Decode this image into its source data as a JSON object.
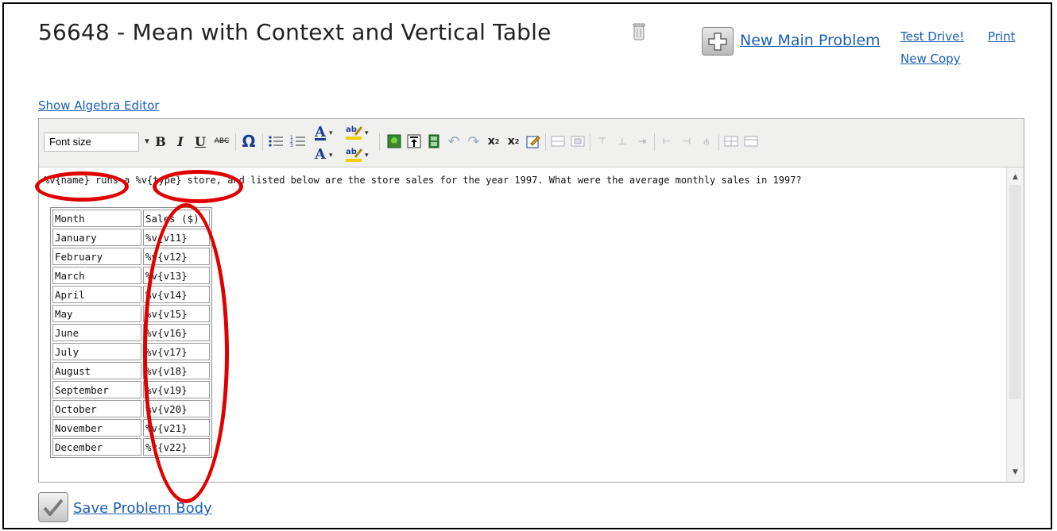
{
  "header": {
    "title": "56648 - Mean with Context and Vertical Table",
    "new_main_problem": "New Main Problem",
    "test_drive": "Test Drive!",
    "print": "Print",
    "new_copy": "New Copy"
  },
  "algebra_link": "Show Algebra Editor",
  "toolbar": {
    "font_size_placeholder": "Font size",
    "bold": "B",
    "italic": "I",
    "underline": "U",
    "strike": "ABC",
    "omega": "Ω"
  },
  "editor": {
    "paragraph": "%v{name} runs a %v{type} store, and listed below are the store sales for the year 1997. What were the average monthly sales in 1997?",
    "table_header": [
      "Month",
      "Sales ($)"
    ],
    "rows": [
      [
        "January",
        "%v{v11}"
      ],
      [
        "February",
        "%v{v12}"
      ],
      [
        "March",
        "%v{v13}"
      ],
      [
        "April",
        "%v{v14}"
      ],
      [
        "May",
        "%v{v15}"
      ],
      [
        "June",
        "%v{v16}"
      ],
      [
        "July",
        "%v{v17}"
      ],
      [
        "August",
        "%v{v18}"
      ],
      [
        "September",
        "%v{v19}"
      ],
      [
        "October",
        "%v{v20}"
      ],
      [
        "November",
        "%v{v21}"
      ],
      [
        "December",
        "%v{v22}"
      ]
    ]
  },
  "save_label": "Save Problem Body",
  "colors": {
    "link": "#1a5fb4",
    "annotation": "#e10000"
  }
}
